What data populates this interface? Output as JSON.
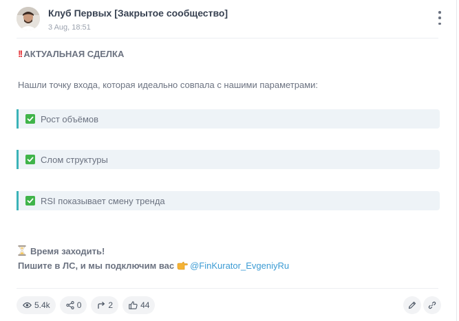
{
  "post": {
    "channel_title": "Клуб Первых [Закрытое сообщество]",
    "date": "3 Aug, 18:51",
    "headline": "АКТУАЛЬНАЯ СДЕЛКА",
    "intro": "Нашли точку входа, которая идеально совпала с нашими параметрами:",
    "points": [
      "Рост объёмов",
      "Слом структуры",
      "RSI показывает смену тренда"
    ],
    "call_to_action": "Время заходить!",
    "contact_text": "Пишите в ЛС, и мы подключим вас",
    "contact_link": "@FinKurator_EvgeniyRu"
  },
  "footer": {
    "views": "5.4k",
    "shares": "0",
    "forwards": "2",
    "likes": "44"
  },
  "colors": {
    "accent_border": "#3bb3b8",
    "link": "#3b9bd4",
    "check_green": "#40b44a",
    "alert_red": "#e5343a"
  },
  "icons": [
    "more-vertical-icon",
    "double-exclamation-icon",
    "check-box-icon",
    "hourglass-icon",
    "pointing-hand-icon",
    "eye-icon",
    "share-icon",
    "forward-icon",
    "thumbs-up-icon",
    "pencil-icon",
    "link-icon"
  ]
}
